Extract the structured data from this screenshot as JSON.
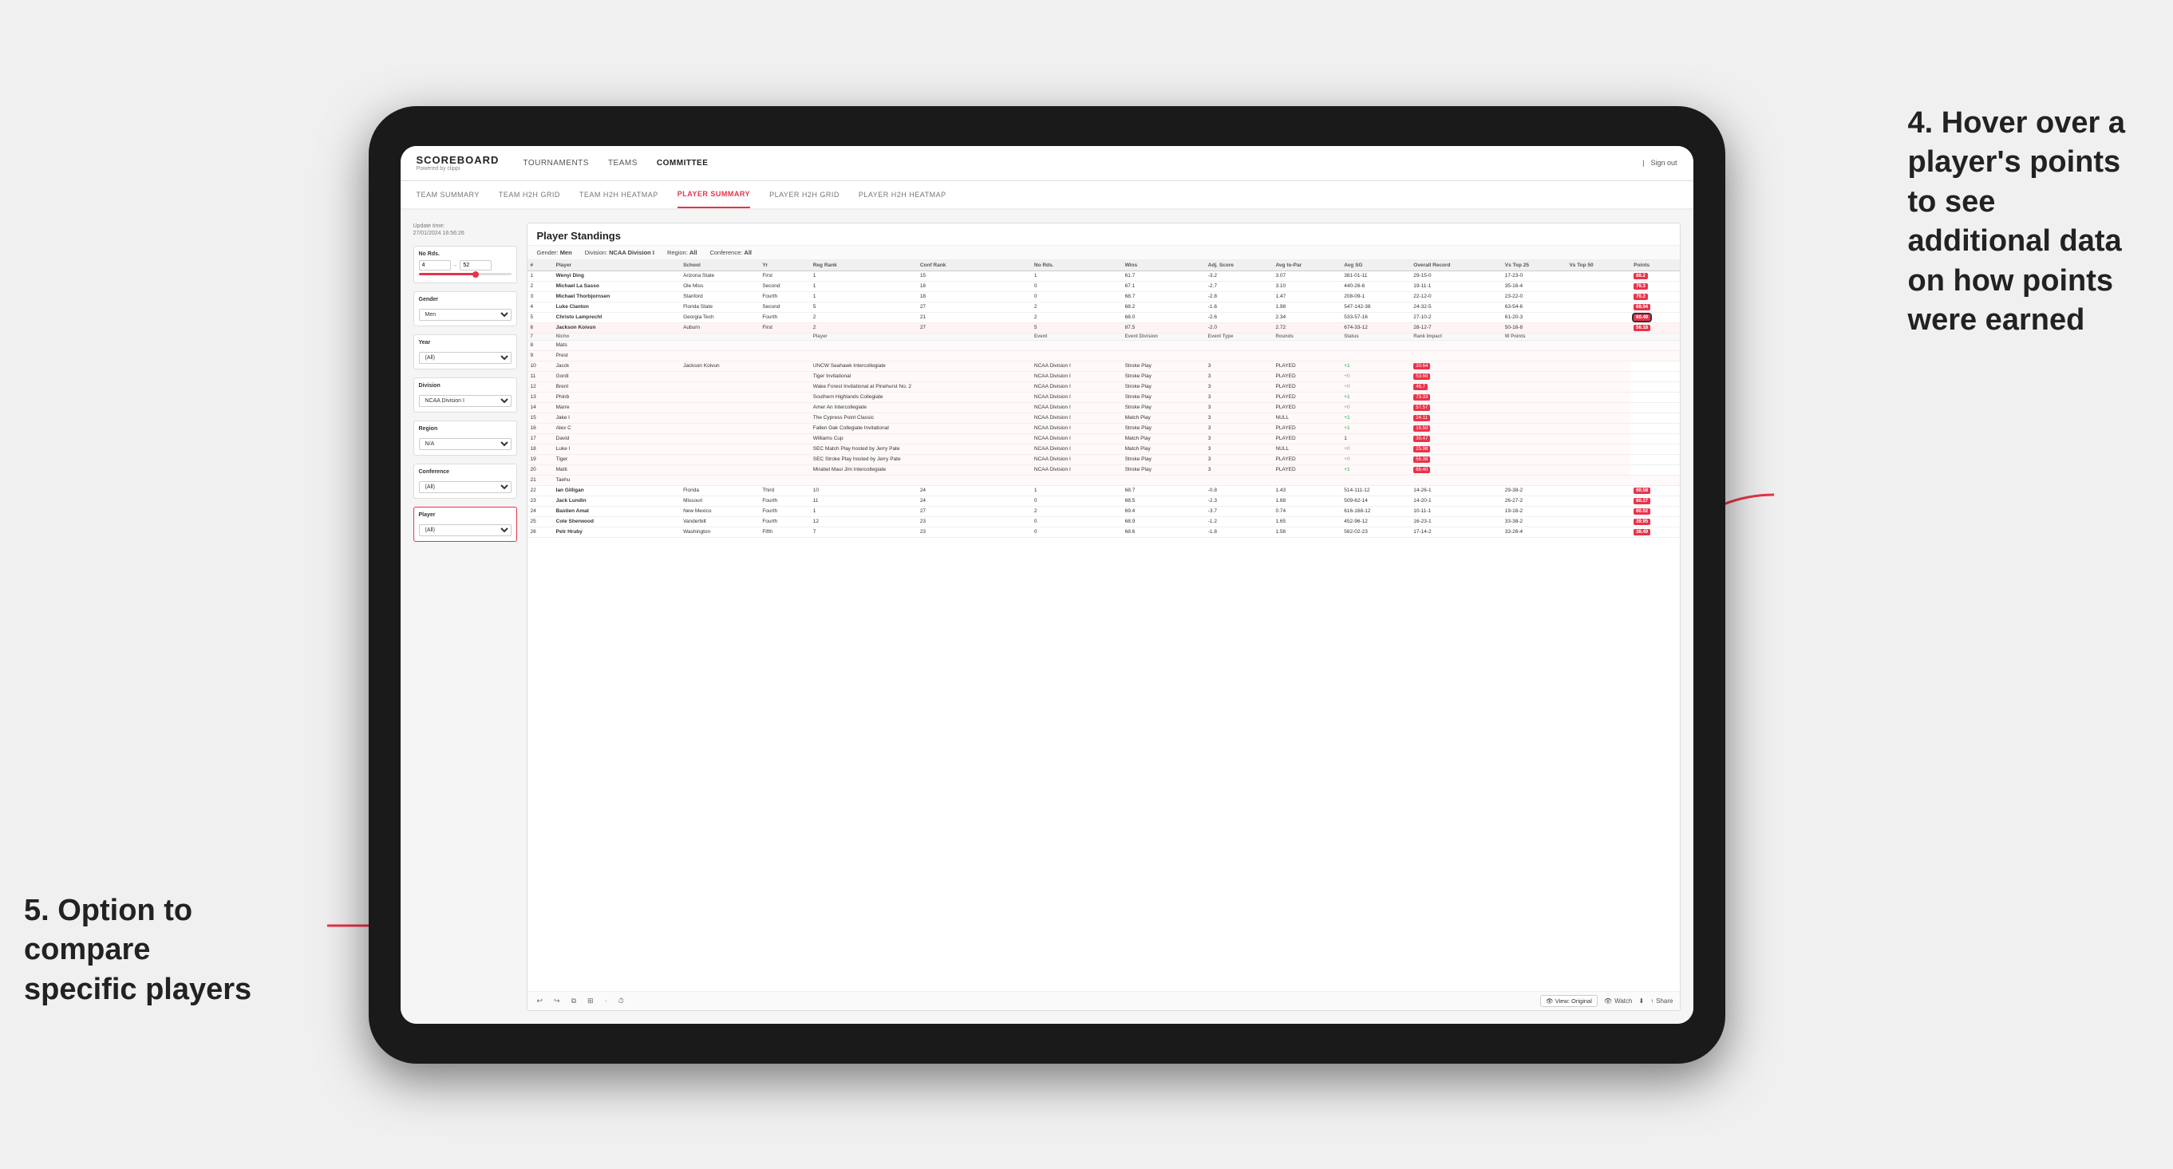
{
  "app": {
    "logo": "SCOREBOARD",
    "logo_sub": "Powered by clippi",
    "sign_out": "Sign out",
    "nav_items": [
      "TOURNAMENTS",
      "TEAMS",
      "COMMITTEE"
    ],
    "sub_nav_items": [
      "TEAM SUMMARY",
      "TEAM H2H GRID",
      "TEAM H2H HEATMAP",
      "PLAYER SUMMARY",
      "PLAYER H2H GRID",
      "PLAYER H2H HEATMAP"
    ],
    "active_sub_nav": "PLAYER SUMMARY"
  },
  "left_panel": {
    "update_time_label": "Update time:",
    "update_time_value": "27/01/2024 16:56:26",
    "no_rds_label": "No Rds.",
    "no_rds_min": "4",
    "no_rds_max": "52",
    "gender_label": "Gender",
    "gender_value": "Men",
    "year_label": "Year",
    "year_value": "(All)",
    "division_label": "Division",
    "division_value": "NCAA Division I",
    "region_label": "Region",
    "region_value": "N/A",
    "conference_label": "Conference",
    "conference_value": "(All)",
    "player_label": "Player",
    "player_value": "(All)"
  },
  "main_panel": {
    "title": "Player Standings",
    "filters": {
      "gender": "Gender: Men",
      "division": "Division: NCAA Division I",
      "region": "Region: All",
      "conference": "Conference: All"
    },
    "table_headers": [
      "#",
      "Player",
      "School",
      "Yr",
      "Reg Rank",
      "Conf Rank",
      "No Rds.",
      "Wins",
      "Adj. Score",
      "Avg to-Par",
      "Avg SG",
      "Overall Record",
      "Vs Top 25",
      "Vs Top 50",
      "Points"
    ],
    "rows": [
      {
        "num": "1",
        "player": "Wenyi Ding",
        "school": "Arizona State",
        "yr": "First",
        "reg_rank": "1",
        "conf_rank": "15",
        "no_rds": "1",
        "wins": "61.7",
        "adj_score": "-3.2",
        "avg_to_par": "3.07",
        "avg_sg": "381-01-11",
        "overall": "29-15-0",
        "vs25": "17-23-0",
        "vs50": "",
        "points": "88.2"
      },
      {
        "num": "2",
        "player": "Michael La Sasso",
        "school": "Ole Miss",
        "yr": "Second",
        "reg_rank": "1",
        "conf_rank": "18",
        "no_rds": "0",
        "wins": "67.1",
        "adj_score": "-2.7",
        "avg_to_par": "3.10",
        "avg_sg": "440-26-6",
        "overall": "19-11-1",
        "vs25": "35-16-4",
        "vs50": "",
        "points": "76.3"
      },
      {
        "num": "3",
        "player": "Michael Thorbjornsen",
        "school": "Stanford",
        "yr": "Fourth",
        "reg_rank": "1",
        "conf_rank": "18",
        "no_rds": "0",
        "wins": "68.7",
        "adj_score": "-2.8",
        "avg_to_par": "1.47",
        "avg_sg": "208-09-1",
        "overall": "22-12-0",
        "vs25": "23-22-0",
        "vs50": "",
        "points": "70.2"
      },
      {
        "num": "4",
        "player": "Luke Clanton",
        "school": "Florida State",
        "yr": "Second",
        "reg_rank": "5",
        "conf_rank": "27",
        "no_rds": "2",
        "wins": "68.2",
        "adj_score": "-1.6",
        "avg_to_par": "1.98",
        "avg_sg": "547-142-38",
        "overall": "24-32-5",
        "vs25": "63-54-6",
        "vs50": "",
        "points": "68.94"
      },
      {
        "num": "5",
        "player": "Christo Lamprecht",
        "school": "Georgia Tech",
        "yr": "Fourth",
        "reg_rank": "2",
        "conf_rank": "21",
        "no_rds": "2",
        "wins": "68.0",
        "adj_score": "-2.6",
        "avg_to_par": "2.34",
        "avg_sg": "533-57-16",
        "overall": "27-10-2",
        "vs25": "61-20-3",
        "vs50": "",
        "points": "60.49"
      },
      {
        "num": "6",
        "player": "Jackson Koivun",
        "school": "Auburn",
        "yr": "First",
        "reg_rank": "2",
        "conf_rank": "27",
        "no_rds": "5",
        "wins": "87.5",
        "adj_score": "-2.0",
        "avg_to_par": "2.72",
        "avg_sg": "674-33-12",
        "overall": "28-12-7",
        "vs25": "50-16-8",
        "vs50": "",
        "points": "56.18"
      }
    ],
    "tooltip_section": {
      "player": "Jackson Koivun",
      "headers": [
        "Player",
        "Event",
        "Event Division",
        "Event Type",
        "Rounds",
        "Status",
        "Rank Impact",
        "W Points"
      ],
      "rows": [
        {
          "num": "7",
          "player": "Nicho",
          "event": "",
          "event_div": "",
          "event_type": "",
          "rounds": "",
          "status": "",
          "rank_impact": "",
          "w_points": ""
        },
        {
          "num": "8",
          "player": "Mats",
          "event": "",
          "event_div": "",
          "event_type": "",
          "rounds": "",
          "status": "",
          "rank_impact": "",
          "w_points": ""
        },
        {
          "num": "9",
          "player": "Prest",
          "event": "",
          "event_div": "",
          "event_type": "",
          "rounds": "",
          "status": "",
          "rank_impact": "",
          "w_points": ""
        },
        {
          "num": "10",
          "player": "Jacck",
          "event": "UNCW Seahawk Intercollegiate",
          "event_div": "NCAA Division I",
          "event_type": "Stroke Play",
          "rounds": "3",
          "status": "PLAYED",
          "rank_impact": "+1",
          "w_points": "20.64"
        },
        {
          "num": "11",
          "player": "Gordi",
          "event": "Tiger Invitational",
          "event_div": "NCAA Division I",
          "event_type": "Stroke Play",
          "rounds": "3",
          "status": "PLAYED",
          "rank_impact": "+0",
          "w_points": "53.60"
        },
        {
          "num": "12",
          "player": "Brent",
          "event": "Wake Forest Invitational at Pinehurst No. 2",
          "event_div": "NCAA Division I",
          "event_type": "Stroke Play",
          "rounds": "3",
          "status": "PLAYED",
          "rank_impact": "+0",
          "w_points": "46.7"
        },
        {
          "num": "13",
          "player": "Phinb",
          "event": "Southern Highlands Collegiate",
          "event_div": "NCAA Division I",
          "event_type": "Stroke Play",
          "rounds": "3",
          "status": "PLAYED",
          "rank_impact": "+1",
          "w_points": "73.33"
        },
        {
          "num": "14",
          "player": "Marre",
          "event": "Amer An Intercollegiate",
          "event_div": "NCAA Division I",
          "event_type": "Stroke Play",
          "rounds": "3",
          "status": "PLAYED",
          "rank_impact": "+0",
          "w_points": "57.57"
        },
        {
          "num": "15",
          "player": "Jake I",
          "event": "The Cypress Point Classic",
          "event_div": "NCAA Division I",
          "event_type": "Match Play",
          "rounds": "3",
          "status": "NULL",
          "rank_impact": "+1",
          "w_points": "24.11"
        },
        {
          "num": "16",
          "player": "Alex C",
          "event": "Fallen Oak Collegiate Invitational",
          "event_div": "NCAA Division I",
          "event_type": "Stroke Play",
          "rounds": "3",
          "status": "PLAYED",
          "rank_impact": "+1",
          "w_points": "16.50"
        },
        {
          "num": "17",
          "player": "David",
          "event": "Williams Cup",
          "event_div": "NCAA Division I",
          "event_type": "Match Play",
          "rounds": "3",
          "status": "PLAYED",
          "rank_impact": "1",
          "w_points": "30.47"
        },
        {
          "num": "18",
          "player": "Luke I",
          "event": "SEC Match Play hosted by Jerry Pate",
          "event_div": "NCAA Division I",
          "event_type": "Match Play",
          "rounds": "3",
          "status": "NULL",
          "rank_impact": "+0",
          "w_points": "25.98"
        },
        {
          "num": "19",
          "player": "Tiger",
          "event": "SEC Stroke Play hosted by Jerry Pate",
          "event_div": "NCAA Division I",
          "event_type": "Stroke Play",
          "rounds": "3",
          "status": "PLAYED",
          "rank_impact": "+0",
          "w_points": "56.38"
        },
        {
          "num": "20",
          "player": "Matti",
          "event": "Mirabel Maui Jim Intercollegiate",
          "event_div": "NCAA Division I",
          "event_type": "Stroke Play",
          "rounds": "3",
          "status": "PLAYED",
          "rank_impact": "+1",
          "w_points": "66.40"
        },
        {
          "num": "21",
          "player": "Taehu",
          "event": "",
          "event_div": "",
          "event_type": "",
          "rounds": "",
          "status": "",
          "rank_impact": "",
          "w_points": ""
        }
      ]
    },
    "lower_rows": [
      {
        "num": "22",
        "player": "Ian Gilligan",
        "school": "Florida",
        "yr": "Third",
        "reg_rank": "10",
        "conf_rank": "24",
        "no_rds": "1",
        "wins": "68.7",
        "adj_score": "-0.8",
        "avg_to_par": "1.43",
        "avg_sg": "514-111-12",
        "overall": "14-26-1",
        "vs25": "29-38-2",
        "vs50": "",
        "points": "60.58"
      },
      {
        "num": "23",
        "player": "Jack Lundin",
        "school": "Missouri",
        "yr": "Fourth",
        "reg_rank": "11",
        "conf_rank": "24",
        "no_rds": "0",
        "wins": "68.5",
        "adj_score": "-2.3",
        "avg_to_par": "1.68",
        "avg_sg": "509-62-14",
        "overall": "14-20-1",
        "vs25": "26-27-2",
        "vs50": "",
        "points": "60.27"
      },
      {
        "num": "24",
        "player": "Bastien Amat",
        "school": "New Mexico",
        "yr": "Fourth",
        "reg_rank": "1",
        "conf_rank": "27",
        "no_rds": "2",
        "wins": "69.4",
        "adj_score": "-3.7",
        "avg_to_par": "0.74",
        "avg_sg": "616-168-12",
        "overall": "10-11-1",
        "vs25": "19-16-2",
        "vs50": "",
        "points": "60.02"
      },
      {
        "num": "25",
        "player": "Cole Sherwood",
        "school": "Vanderbilt",
        "yr": "Fourth",
        "reg_rank": "12",
        "conf_rank": "23",
        "no_rds": "0",
        "wins": "68.9",
        "adj_score": "-1.2",
        "avg_to_par": "1.65",
        "avg_sg": "452-96-12",
        "overall": "16-23-1",
        "vs25": "33-38-2",
        "vs50": "",
        "points": "39.95"
      },
      {
        "num": "26",
        "player": "Petr Hruby",
        "school": "Washington",
        "yr": "Fifth",
        "reg_rank": "7",
        "conf_rank": "23",
        "no_rds": "0",
        "wins": "68.6",
        "adj_score": "-1.8",
        "avg_to_par": "1.56",
        "avg_sg": "562-02-23",
        "overall": "17-14-2",
        "vs25": "33-26-4",
        "vs50": "",
        "points": "38.49"
      }
    ]
  },
  "toolbar": {
    "undo": "↩",
    "redo": "↪",
    "copy": "⧉",
    "paste": "⊞",
    "separator": "·",
    "clock": "⏱",
    "view_original": "View: Original",
    "watch": "Watch",
    "download": "⬇",
    "share": "Share"
  },
  "annotations": {
    "top_right": "4. Hover over a\nplayer's points\nto see\nadditional data\non how points\nwere earned",
    "bottom_left": "5. Option to\ncompare\nspecific players"
  }
}
